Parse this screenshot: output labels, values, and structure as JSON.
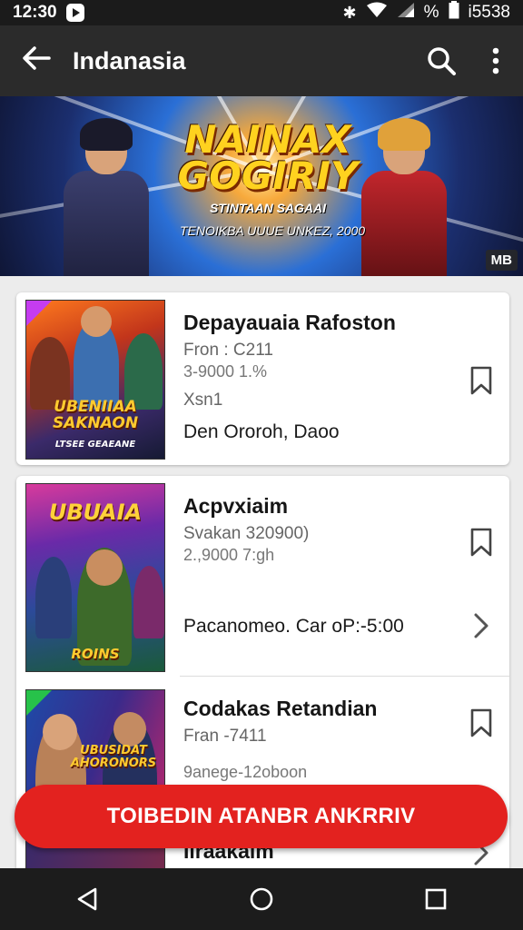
{
  "status_bar": {
    "time": "12:30",
    "battery_text": "%",
    "right_text": "i5538"
  },
  "app_bar": {
    "title": "Indanasia"
  },
  "banner": {
    "headline_line1": "NAINAX",
    "headline_line2": "GOGIRIY",
    "subtitle": "STINTAAN SAGAAI",
    "tagline": "TENOIKBA  UUUE  UNKEZ, 2000",
    "badge": "MB"
  },
  "items": [
    {
      "thumb_title": "UBENIIAA SAKNAON",
      "thumb_sub": "LTSEE GEAEANE",
      "name": "Depayauaia Rafoston",
      "line1": "Fron : C211",
      "line2": "3-9000 1.%",
      "line3": "Xsn1",
      "line4": "Den Ororoh, Daoo"
    },
    {
      "thumb_title": "UBUAIA",
      "thumb_sub": "ROINS",
      "name": "Acpvxiaim",
      "line1": "Svakan 320900)",
      "line2": "2.,9000 7:gh",
      "line4": "Pacanomeo. Car oP:-5:00"
    },
    {
      "thumb_title": "UBUSIDAT AHORONORS",
      "name": "Codakas Retandian",
      "line1": "Fran -7411",
      "line2": "9anege-12oboon"
    },
    {
      "name": "Iiraakaim"
    }
  ],
  "cta": {
    "label": "TOIBEDIN ATANBR ANKRRIV"
  },
  "colors": {
    "accent": "#e3221f",
    "app_bar": "#2b2b2b",
    "status_bar": "#1b1b1b"
  },
  "icons": [
    "back-arrow-icon",
    "search-icon",
    "more-vert-icon",
    "bookmark-icon",
    "chevron-right-icon",
    "nav-back-icon",
    "nav-home-icon",
    "nav-recents-icon"
  ]
}
